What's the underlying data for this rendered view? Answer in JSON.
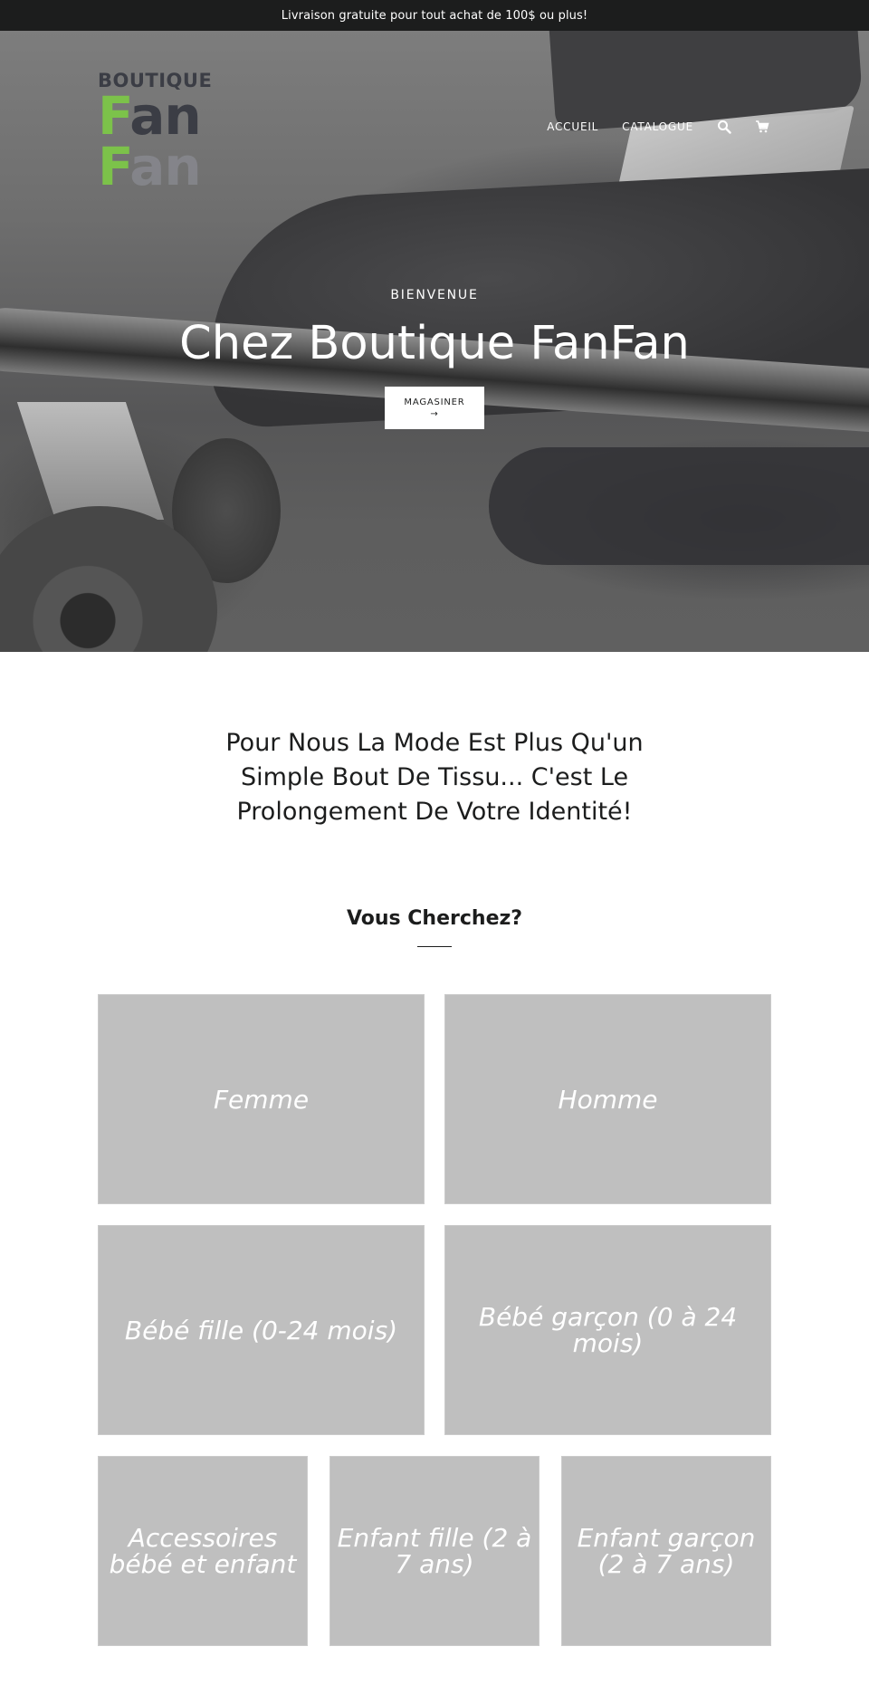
{
  "announcement": {
    "text": "Livraison gratuite pour tout achat de 100$ ou plus!"
  },
  "header": {
    "logo": {
      "line1": "BOUTIQUE",
      "line2_accent": "F",
      "line2_rest": "an",
      "line3_accent": "F",
      "line3_rest": "an",
      "accent_color": "#7cc24a",
      "text_color": "#3b3d45"
    },
    "nav": [
      {
        "label": "ACCUEIL"
      },
      {
        "label": "CATALOGUE"
      }
    ],
    "icons": {
      "search": "search-icon",
      "cart": "cart-icon"
    }
  },
  "hero": {
    "kicker": "BIENVENUE",
    "title": "Chez Boutique FanFan",
    "button_label": "MAGASINER",
    "button_arrow": "→",
    "slides": {
      "count": 5,
      "active_index": 0
    }
  },
  "tagline": "Pour Nous La Mode Est Plus Qu'un Simple Bout De Tissu... C'est Le Prolongement De Votre Identité!",
  "collections": {
    "title": "Vous Cherchez?",
    "rows": [
      [
        {
          "label": "Femme"
        },
        {
          "label": "Homme"
        }
      ],
      [
        {
          "label": "Bébé fille (0-24 mois)"
        },
        {
          "label": "Bébé garçon (0 à 24 mois)"
        }
      ],
      [
        {
          "label": "Accessoires bébé et enfant"
        },
        {
          "label": "Enfant fille (2 à 7 ans)"
        },
        {
          "label": "Enfant garçon (2 à 7 ans)"
        }
      ]
    ],
    "tile_color": "#bfbfbf"
  }
}
